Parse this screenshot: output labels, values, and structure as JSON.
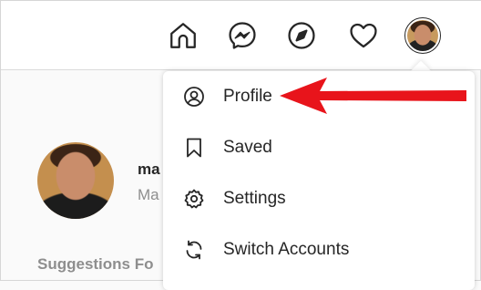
{
  "profile": {
    "username": "ma",
    "fullname": "Ma"
  },
  "suggestions_label": "Suggestions Fo",
  "menu": {
    "items": [
      {
        "label": "Profile",
        "icon": "profile-icon"
      },
      {
        "label": "Saved",
        "icon": "bookmark-icon"
      },
      {
        "label": "Settings",
        "icon": "gear-icon"
      },
      {
        "label": "Switch Accounts",
        "icon": "switch-icon"
      }
    ]
  },
  "nav": {
    "icons": [
      "home-icon",
      "messenger-icon",
      "compass-icon",
      "heart-icon",
      "avatar"
    ]
  },
  "colors": {
    "annotation_arrow": "#e8141b",
    "text": "#262626",
    "muted": "#8e8e8e"
  }
}
